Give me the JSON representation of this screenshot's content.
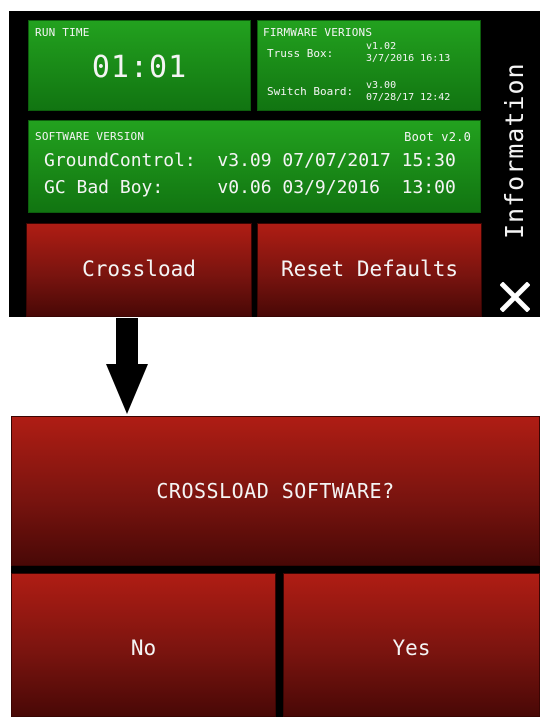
{
  "run_time": {
    "label": "RUN TIME",
    "value": "01:01"
  },
  "firmware": {
    "label": "FIRMWARE VERIONS",
    "truss_box": {
      "label": "Truss Box:",
      "version": "v1.02",
      "date": "3/7/2016 16:13"
    },
    "switch_board": {
      "label": "Switch Board:",
      "version": "v3.00",
      "date": "07/28/17 12:42"
    }
  },
  "software": {
    "label": "SOFTWARE VERSION",
    "boot": "Boot v2.0",
    "rows": [
      "GroundControl:  v3.09 07/07/2017 15:30",
      "GC Bad Boy:     v0.06 03/9/2016  13:00"
    ]
  },
  "buttons": {
    "crossload": "Crossload",
    "reset_defaults": "Reset Defaults"
  },
  "sidebar": {
    "title": "Information",
    "close_icon": "close-icon"
  },
  "dialog": {
    "title": "CROSSLOAD SOFTWARE?",
    "no": "No",
    "yes": "Yes"
  },
  "colors": {
    "green": "#1a8f18",
    "red": "#8c1a12",
    "background": "#000000"
  }
}
